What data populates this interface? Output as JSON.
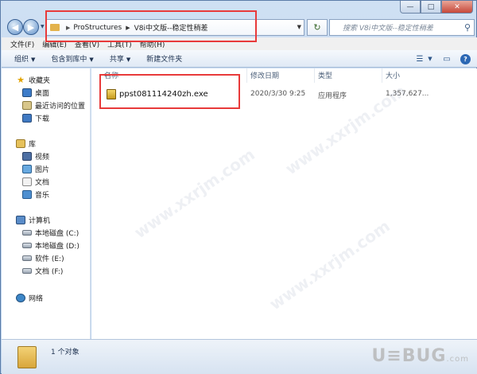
{
  "window": {
    "minimize_glyph": "—",
    "maximize_glyph": "□",
    "close_glyph": "✕"
  },
  "address_bar": {
    "segments": [
      "ProStructures",
      "V8i中文版--稳定性稍差"
    ],
    "refresh_glyph": "↻",
    "search_placeholder": "搜索 V8i中文版--稳定性稍差",
    "search_icon": "search-icon"
  },
  "menu": {
    "items": [
      "文件(F)",
      "编辑(E)",
      "查看(V)",
      "工具(T)",
      "帮助(H)"
    ]
  },
  "toolbar": {
    "organize": "组织",
    "include_in_library": "包含到库中",
    "share": "共享",
    "new_folder": "新建文件夹",
    "view_glyph": "☰",
    "pane_glyph": "▭",
    "help_glyph": "?"
  },
  "sidebar": {
    "favorites": {
      "label": "收藏夹",
      "items": [
        "桌面",
        "最近访问的位置",
        "下载"
      ]
    },
    "libraries": {
      "label": "库",
      "items": [
        "视频",
        "图片",
        "文档",
        "音乐"
      ]
    },
    "computer": {
      "label": "计算机",
      "items": [
        "本地磁盘 (C:)",
        "本地磁盘 (D:)",
        "软件 (E:)",
        "文档 (F:)"
      ]
    },
    "network": {
      "label": "网络"
    }
  },
  "columns": [
    "名称",
    "修改日期",
    "类型",
    "大小"
  ],
  "files": [
    {
      "name": "ppst081114240zh.exe",
      "modified": "2020/3/30 9:25",
      "type": "应用程序",
      "size": "1,357,627..."
    }
  ],
  "status": {
    "count": "1 个对象"
  },
  "branding": {
    "watermark": "www.xxrjm.com",
    "logo": "U≡BUG",
    "logo_suffix": ".com"
  },
  "colors": {
    "highlight": "#e83a3a",
    "accent": "#2c68b4"
  }
}
